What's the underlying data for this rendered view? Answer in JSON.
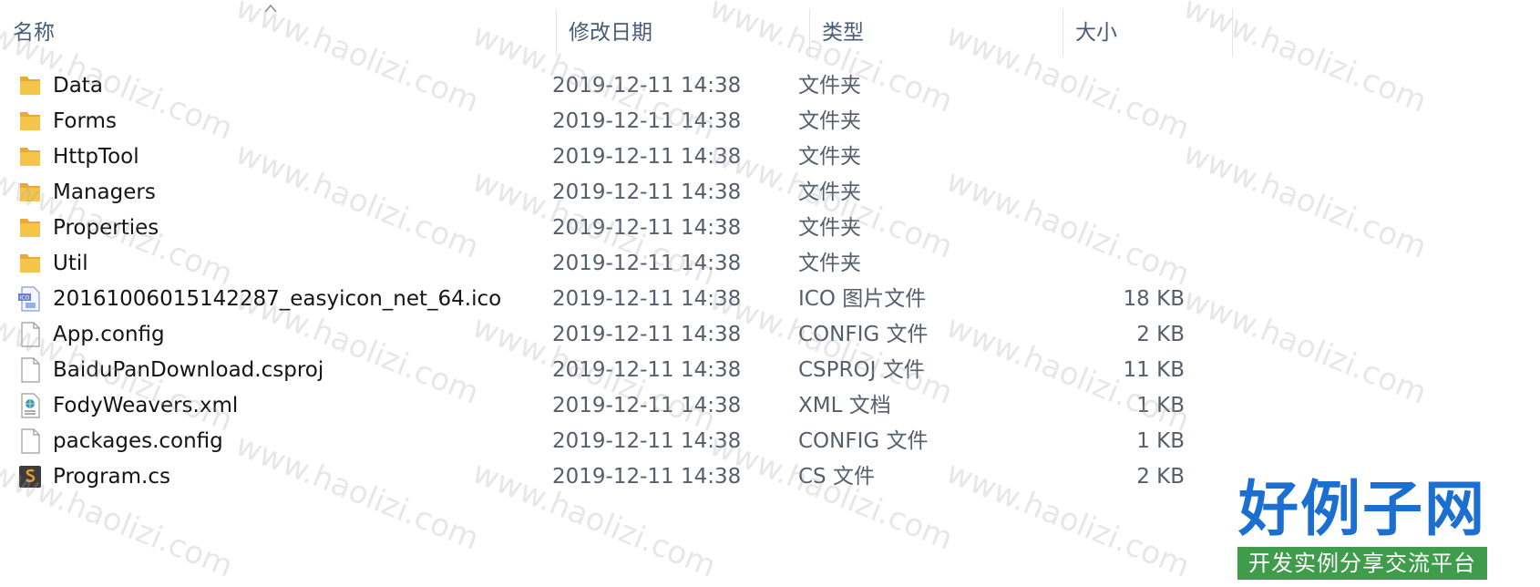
{
  "header": {
    "columns": {
      "name": "名称",
      "date": "修改日期",
      "type": "类型",
      "size": "大小"
    }
  },
  "files": [
    {
      "name": "Data",
      "date": "2019-12-11 14:38",
      "type": "文件夹",
      "size": "",
      "icon": "folder-icon"
    },
    {
      "name": "Forms",
      "date": "2019-12-11 14:38",
      "type": "文件夹",
      "size": "",
      "icon": "folder-icon"
    },
    {
      "name": "HttpTool",
      "date": "2019-12-11 14:38",
      "type": "文件夹",
      "size": "",
      "icon": "folder-icon"
    },
    {
      "name": "Managers",
      "date": "2019-12-11 14:38",
      "type": "文件夹",
      "size": "",
      "icon": "folder-icon"
    },
    {
      "name": "Properties",
      "date": "2019-12-11 14:38",
      "type": "文件夹",
      "size": "",
      "icon": "folder-icon"
    },
    {
      "name": "Util",
      "date": "2019-12-11 14:38",
      "type": "文件夹",
      "size": "",
      "icon": "folder-icon"
    },
    {
      "name": "20161006015142287_easyicon_net_64.ico",
      "date": "2019-12-11 14:38",
      "type": "ICO 图片文件",
      "size": "18 KB",
      "icon": "ico-file-icon"
    },
    {
      "name": "App.config",
      "date": "2019-12-11 14:38",
      "type": "CONFIG 文件",
      "size": "2 KB",
      "icon": "blank-file-icon"
    },
    {
      "name": "BaiduPanDownload.csproj",
      "date": "2019-12-11 14:38",
      "type": "CSPROJ 文件",
      "size": "11 KB",
      "icon": "blank-file-icon"
    },
    {
      "name": "FodyWeavers.xml",
      "date": "2019-12-11 14:38",
      "type": "XML 文档",
      "size": "1 KB",
      "icon": "xml-file-icon"
    },
    {
      "name": "packages.config",
      "date": "2019-12-11 14:38",
      "type": "CONFIG 文件",
      "size": "1 KB",
      "icon": "blank-file-icon"
    },
    {
      "name": "Program.cs",
      "date": "2019-12-11 14:38",
      "type": "CS 文件",
      "size": "2 KB",
      "icon": "cs-file-icon"
    }
  ],
  "watermark": {
    "text": "www.haolizi.com",
    "brand_title": "好例子网",
    "brand_subtitle": "开发实例分享交流平台"
  },
  "colors": {
    "header_text": "#4a5b78",
    "folder": "#f5c44a",
    "brand_blue": "#1b6fd1",
    "brand_green": "#3f9c4a"
  }
}
